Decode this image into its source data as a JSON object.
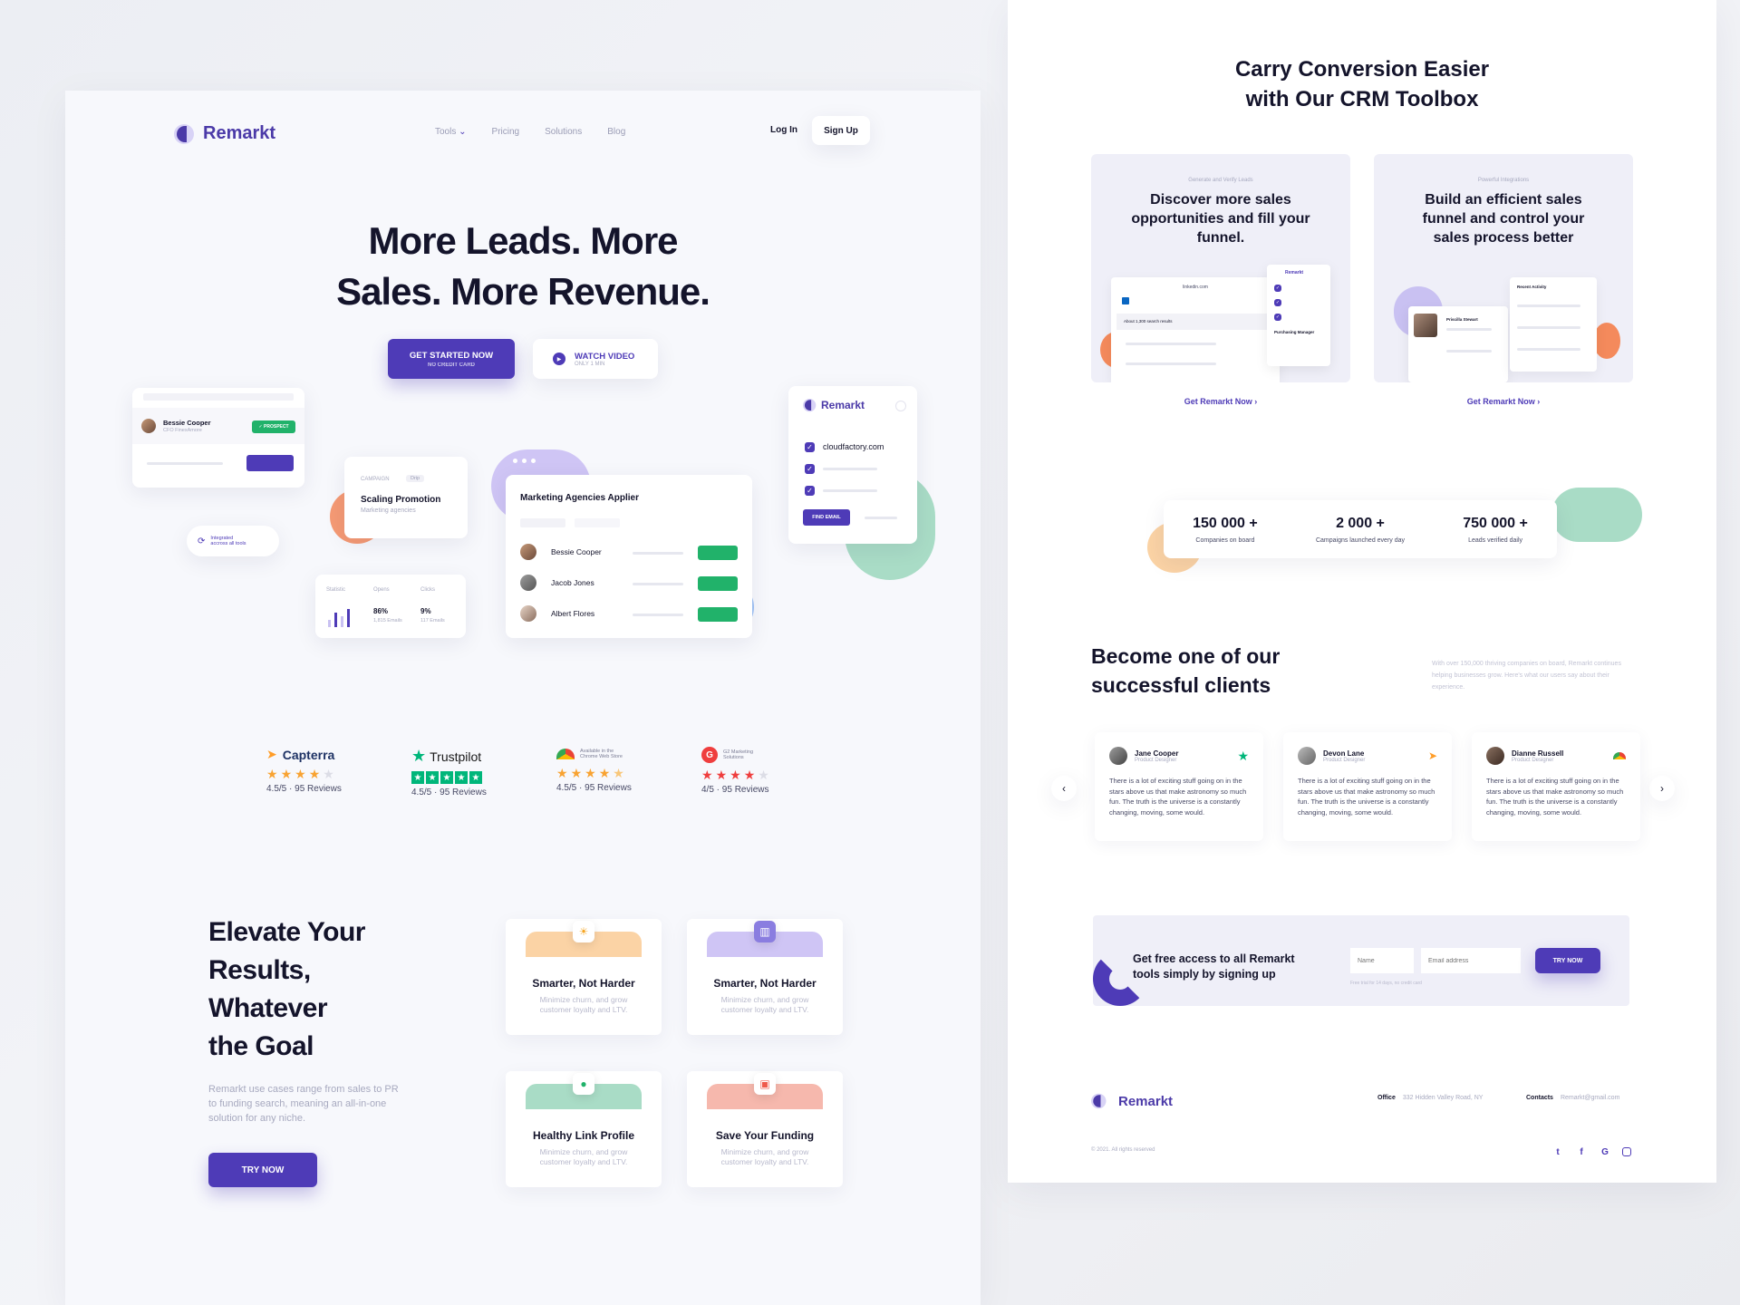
{
  "left": {
    "brand": "Remarkt",
    "nav": {
      "tools": "Tools",
      "pricing": "Pricing",
      "solutions": "Solutions",
      "blog": "Blog",
      "login": "Log In",
      "signup": "Sign Up"
    },
    "hero": {
      "title_line1": "More Leads. More",
      "title_line2": "Sales. More Revenue.",
      "cta_primary": "GET STARTED NOW",
      "cta_primary_sub": "NO CREDIT CARD",
      "cta_secondary": "WATCH VIDEO",
      "cta_secondary_sub": "ONLY 1 MIN"
    },
    "mock": {
      "profile_name": "Bessie Cooper",
      "profile_role": "CFO FinexAmore",
      "prospect_badge": "✓ PROSPECT",
      "campaign_label": "CAMPAIGN",
      "campaign_tag": "Drip",
      "campaign_title": "Scaling Promotion",
      "campaign_sub": "Marketing agencies",
      "integrated_text_1": "Integrated",
      "integrated_text_2": "accross all tools",
      "stats_headers": [
        "Statistic",
        "Opens",
        "Clicks"
      ],
      "stats_opens": "86%",
      "stats_opens_sub": "1,815 Emails",
      "stats_clicks": "9%",
      "stats_clicks_sub": "117 Emails",
      "applier_title": "Marketing Agencies Applier",
      "applier_rows": [
        "Bessie Cooper",
        "Jacob Jones",
        "Albert Flores"
      ],
      "domain_brand": "Remarkt",
      "domain": "cloudfactory.com",
      "find_email": "FIND EMAIL"
    },
    "ratings": [
      {
        "name": "Capterra",
        "score": "4.5/5 · 95 Reviews",
        "stars": 4.5
      },
      {
        "name": "Trustpilot",
        "score": "4.5/5 · 95 Reviews",
        "stars": 5
      },
      {
        "name_line1": "Available in the",
        "name_line2": "Chrome Web Store",
        "score": "4.5/5 · 95 Reviews",
        "stars": 4.5
      },
      {
        "name_line1": "G2 Marketing",
        "name_line2": "Solutions",
        "score": "4/5 · 95 Reviews",
        "stars": 4
      }
    ],
    "elevate": {
      "title": [
        "Elevate Your",
        "Results,",
        "Whatever",
        "the Goal"
      ],
      "desc": "Remarkt use cases range from sales to PR to funding search, meaning an all-in-one solution for any niche.",
      "cta": "TRY NOW"
    },
    "features": [
      {
        "title": "Smarter, Not Harder",
        "desc": "Minimize churn, and grow customer loyalty and LTV.",
        "color": "#fbd3a5",
        "icon": "sun-icon"
      },
      {
        "title": "Smarter, Not Harder",
        "desc": "Minimize churn, and grow customer loyalty and LTV.",
        "color": "#cfc5f5",
        "icon": "chart-icon"
      },
      {
        "title": "Healthy Link Profile",
        "desc": "Minimize churn, and grow customer loyalty and LTV.",
        "color": "#a9dcc6",
        "icon": "user-icon"
      },
      {
        "title": "Save Your Funding",
        "desc": "Minimize churn, and grow customer loyalty and LTV.",
        "color": "#f6b8ad",
        "icon": "wallet-icon"
      }
    ]
  },
  "right": {
    "title_line1": "Carry Conversion Easier",
    "title_line2": "with Our CRM Toolbox",
    "tools": [
      {
        "eyebrow": "Generate and Verify Leads",
        "title": "Discover more sales opportunities and fill your funnel.",
        "link": "Get Remarkt Now ›"
      },
      {
        "eyebrow": "Powerful Integrations",
        "title": "Build an efficient sales funnel and control your sales process better",
        "link": "Get Remarkt Now ›"
      }
    ],
    "tool_mock": {
      "site": "linkedin.com",
      "results": "About 1,300 search results",
      "brand": "Remarkt",
      "role": "Purchasing Manager",
      "activity": "Recent Activity",
      "person": "Priscilla Stewart"
    },
    "stats": [
      {
        "value": "150 000 +",
        "label": "Companies on board"
      },
      {
        "value": "2 000 +",
        "label": "Campaigns launched every day"
      },
      {
        "value": "750 000 +",
        "label": "Leads verified daily"
      }
    ],
    "clients": {
      "title_line1": "Become one of our",
      "title_line2": "successful clients",
      "desc": "With over 150,000 thriving companies on board, Remarkt continues helping businesses grow. Here's what our users say about their experience."
    },
    "testimonials": [
      {
        "name": "Jane Cooper",
        "role": "Product Designer",
        "text": "There is a lot of exciting stuff going on in the stars above us that make astronomy so much fun. The truth is the universe is a constantly changing, moving, some would."
      },
      {
        "name": "Devon Lane",
        "role": "Product Designer",
        "text": "There is a lot of exciting stuff going on in the stars above us that make astronomy so much fun. The truth is the universe is a constantly changing, moving, some would."
      },
      {
        "name": "Dianne Russell",
        "role": "Product Designer",
        "text": "There is a lot of exciting stuff going on in the stars above us that make astronomy so much fun. The truth is the universe is a constantly changing, moving, some would."
      }
    ],
    "signup": {
      "text": "Get free access to all Remarkt tools simply by signing up",
      "name_placeholder": "Name",
      "email_placeholder": "Email address",
      "note": "Free trial for 14 days, no credit card",
      "cta": "TRY NOW"
    },
    "footer": {
      "brand": "Remarkt",
      "office_label": "Office",
      "office": "332 Hidden Valley Road, NY",
      "contacts_label": "Contacts",
      "contacts": "Remarkt@gmail.com",
      "copyright": "© 2021. All rights reserved",
      "socials": [
        "twitter-icon",
        "facebook-icon",
        "google-icon",
        "instagram-icon"
      ]
    }
  },
  "colors": {
    "brand": "#4e3bb7",
    "green": "#21b26a",
    "orange": "#f48a5c",
    "mint": "#a9dcc6"
  }
}
